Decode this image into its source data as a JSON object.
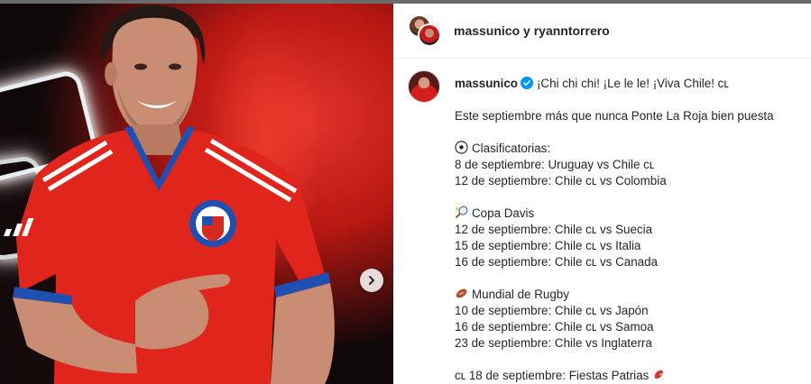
{
  "header": {
    "collab_names": "massunico y ryanntorrero"
  },
  "post": {
    "username": "massunico",
    "headline": "¡Chi chi chi! ¡Le le le! ¡Viva Chile! cʟ",
    "intro": "Este septiembre más que nunca Ponte La Roja bien puesta",
    "sections": [
      {
        "icon": "soccer-ball-icon",
        "title": "Clasificatorias:",
        "lines": [
          "8 de septiembre: Uruguay vs Chile cʟ",
          "12 de septiembre: Chile cʟ vs Colombia"
        ]
      },
      {
        "icon": "tennis-racket-icon",
        "title": "Copa Davis",
        "lines": [
          "12 de septiembre: Chile cʟ vs Suecia",
          "15 de septiembre: Chile cʟ vs Italia",
          "16 de septiembre: Chile cʟ vs Canada"
        ]
      },
      {
        "icon": "rugby-ball-icon",
        "title": "Mundial de Rugby",
        "lines": [
          "10 de septiembre: Chile cʟ vs Japón",
          "16 de septiembre: Chile cʟ vs Samoa",
          "23 de septiembre: Chile vs Inglaterra"
        ]
      }
    ],
    "closing": "cʟ 18 de septiembre: Fiestas Patrias"
  },
  "colors": {
    "verified_blue": "#0095f6",
    "jersey_red": "#e0251c",
    "jersey_blue": "#1f4fb0"
  }
}
